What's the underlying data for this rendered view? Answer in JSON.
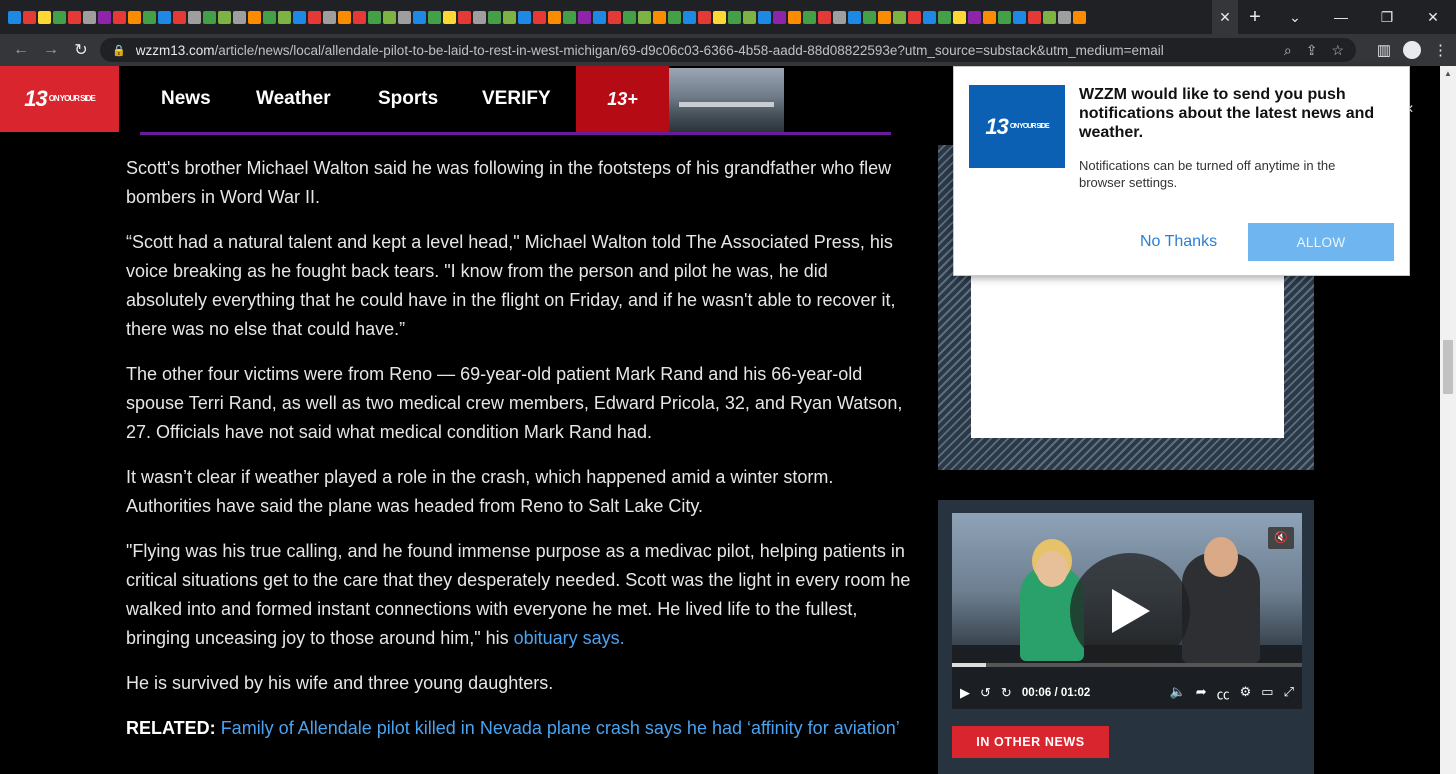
{
  "browser": {
    "url_domain": "wzzm13.com",
    "url_path": "/article/news/local/allendale-pilot-to-be-laid-to-rest-in-west-michigan/69-d9c06c03-6366-4b58-aadd-88d08822593e?utm_source=substack&utm_medium=email"
  },
  "site": {
    "logo_number": "13",
    "logo_tag": "ON YOUR SIDE",
    "nav": [
      "News",
      "Weather",
      "Sports",
      "VERIFY"
    ],
    "promo_number": "13",
    "promo_plus": "+"
  },
  "article": {
    "paragraphs": [
      "Scott's brother Michael Walton said he was following in the footsteps of his grandfather who flew bombers in Word War II.",
      "“Scott had a natural talent and kept a level head,\" Michael Walton told The Associated Press, his voice breaking as he fought back tears. \"I know from the person and pilot he was, he did absolutely everything that he could have in the flight on Friday, and if he wasn't able to recover it, there was no else that could have.”",
      "The other four victims were from Reno — 69-year-old patient Mark Rand and his 66-year-old spouse Terri Rand, as well as two medical crew members, Edward Pricola, 32, and Ryan Watson, 27. Officials have not said what medical condition Mark Rand had.",
      "It wasn’t clear if weather played a role in the crash, which happened amid a winter storm. Authorities have said the plane was headed from Reno to Salt Lake City."
    ],
    "quote_text": "\"Flying was his true calling, and he found immense purpose as a medivac pilot, helping patients in critical situations get to the care that they desperately needed. Scott was the light in every room he walked into and formed instant connections with everyone he met. He lived life to the fullest, bringing unceasing joy to those around him,\" his ",
    "quote_link": "obituary says.",
    "survived": "He is survived by his wife and three young daughters.",
    "related_label": "RELATED:",
    "related_link": "Family of Allendale pilot killed in Nevada plane crash says he had ‘affinity for aviation’"
  },
  "video": {
    "current_time": "00:06",
    "separator": "/",
    "duration": "01:02",
    "progress_fraction": 0.097
  },
  "sidebar": {
    "other_news_label": "IN OTHER NEWS"
  },
  "push_prompt": {
    "logo_number": "13",
    "logo_tag": "ON YOUR SIDE",
    "title": "WZZM would like to send you push notifications about the latest news and weather.",
    "subtitle": "Notifications can be turned off anytime in the browser settings.",
    "no_thanks": "No Thanks",
    "allow": "ALLOW"
  },
  "colors": {
    "brand_red": "#d9262e",
    "link_blue": "#4ba3f0",
    "allow_blue": "#6fb6f0"
  }
}
